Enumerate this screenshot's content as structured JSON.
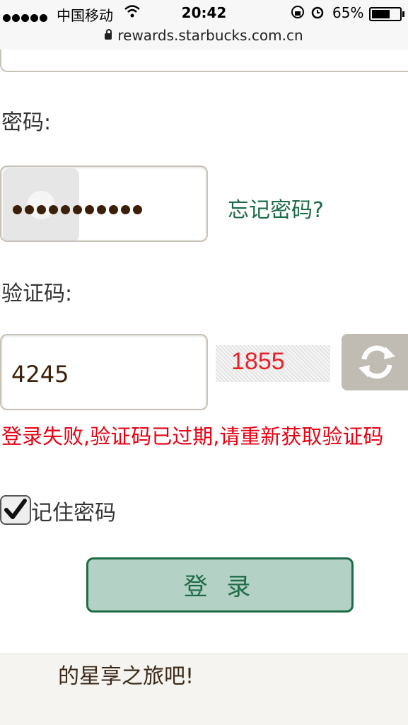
{
  "status_bar": {
    "carrier": "中国移动",
    "time": "20:42",
    "battery_percent": "65%",
    "battery_level": 0.65,
    "url": "rewards.starbucks.com.cn"
  },
  "form": {
    "password_label": "密码:",
    "password_mask": "●●●●●●●●●●●",
    "forgot_link": "忘记密码?",
    "captcha_label": "验证码:",
    "captcha_value": "4245",
    "captcha_image_text": "1855",
    "error_message": "登录失败,验证码已过期,请重新获取验证码",
    "remember_label": "记住密码",
    "remember_checked": true,
    "login_button": "登 录"
  },
  "footer": {
    "text": "的星享之旅吧!"
  },
  "colors": {
    "brand_green": "#1e6b48",
    "error_red": "#e60012",
    "button_bg": "#b4d1c5"
  }
}
